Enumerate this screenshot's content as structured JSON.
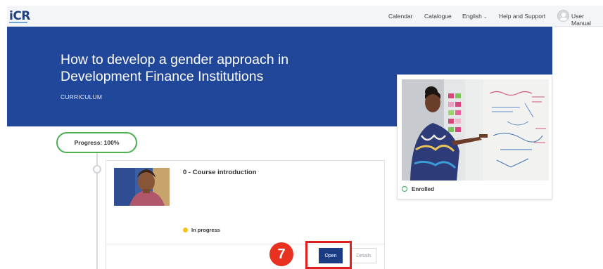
{
  "app": {
    "logo": "iCR"
  },
  "nav": {
    "items": [
      "Calendar",
      "Catalogue",
      "English",
      "Help and Support",
      "User Manual"
    ]
  },
  "hero": {
    "title": "How to develop a gender approach in Development Finance Institutions",
    "subtitle": "CURRICULUM"
  },
  "enrollment": {
    "status": "Enrolled",
    "image_icon": "presenter-whiteboard-photo"
  },
  "progress": {
    "label": "Progress: 100%",
    "value_percent": 100
  },
  "course": {
    "title": "0 - Course introduction",
    "status": "In progress",
    "open_label": "Open",
    "details_label": "Details",
    "thumbnail_icon": "woman-portrait-photo"
  },
  "annotation": {
    "step": "7"
  },
  "colors": {
    "brand_blue": "#21479a",
    "button_blue": "#1c3d83",
    "progress_green": "#4caf50",
    "status_yellow": "#f0c419",
    "annotation_red": "#e02020"
  }
}
